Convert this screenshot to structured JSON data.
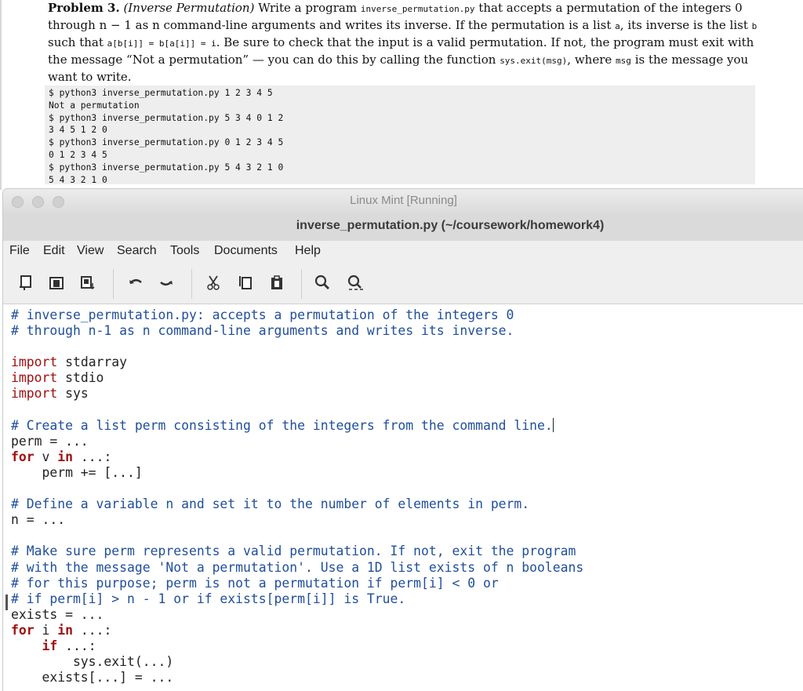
{
  "doc": {
    "problem_label": "Problem 3.",
    "problem_title": "(Inverse Permutation)",
    "lines": [
      "Write a program",
      "inverse_permutation.py",
      "that accepts a permutation of the integers 0",
      "through n − 1 as n command-line arguments and writes its inverse. If the permutation is a list",
      "a",
      ", its inverse is the list",
      "b",
      "such",
      "that",
      "a[b[i]] = b[a[i]] = i",
      ". Be sure to check that the input is a valid permutation. If not, the program must exit with the",
      "message “Not a permutation” — you can do this by calling the function",
      "sys.exit(msg)",
      ", where",
      "msg",
      "is the message you want to",
      "write."
    ],
    "terminal": [
      "$ python3 inverse_permutation.py 1 2 3 4 5",
      "Not a permutation",
      "$ python3 inverse_permutation.py 5 3 4 0 1 2",
      "3 4 5 1 2 0",
      "$ python3 inverse_permutation.py 0 1 2 3 4 5",
      "0 1 2 3 4 5",
      "$ python3 inverse_permutation.py 5 4 3 2 1 0",
      "5 4 3 2 1 0"
    ]
  },
  "window": {
    "vm_title": "Linux Mint [Running]",
    "gedit_title": "inverse_permutation.py (~/coursework/homework4)",
    "menu": [
      "File",
      "Edit",
      "View",
      "Search",
      "Tools",
      "Documents",
      "Help"
    ],
    "toolbar_icons": [
      "new-document-icon",
      "open-icon",
      "save-icon",
      "undo-icon",
      "redo-icon",
      "cut-icon",
      "copy-icon",
      "paste-icon",
      "find-icon",
      "find-replace-icon"
    ]
  },
  "code": {
    "l1": "# inverse_permutation.py: accepts a permutation of the integers 0",
    "l2": "# through n-1 as n command-line arguments and writes its inverse.",
    "l3": "",
    "l4_kw": "import",
    "l4_rest": " stdarray",
    "l5_kw": "import",
    "l5_rest": " stdio",
    "l6_kw": "import",
    "l6_rest": " sys",
    "l7": "",
    "l8": "# Create a list perm consisting of the integers from the command line.",
    "l9": "perm = ...",
    "l10_kw": "for",
    "l10_a": " v ",
    "l10_kw2": "in",
    "l10_b": " ...:",
    "l11": "    perm += [...]",
    "l12": "",
    "l13": "# Define a variable n and set it to the number of elements in perm.",
    "l14": "n = ...",
    "l15": "",
    "l16": "# Make sure perm represents a valid permutation. If not, exit the program",
    "l17": "# with the message 'Not a permutation'. Use a 1D list exists of n booleans",
    "l18": "# for this purpose; perm is not a permutation if perm[i] < 0 or",
    "l19": "# if perm[i] > n - 1 or if exists[perm[i]] is True.",
    "l20": "exists = ...",
    "l21_kw": "for",
    "l21_a": " i ",
    "l21_kw2": "in",
    "l21_b": " ...:",
    "l22_pre": "    ",
    "l22_kw": "if",
    "l22_b": " ...:",
    "l23": "        sys.exit(...)",
    "l24": "    exists[...] = ..."
  }
}
